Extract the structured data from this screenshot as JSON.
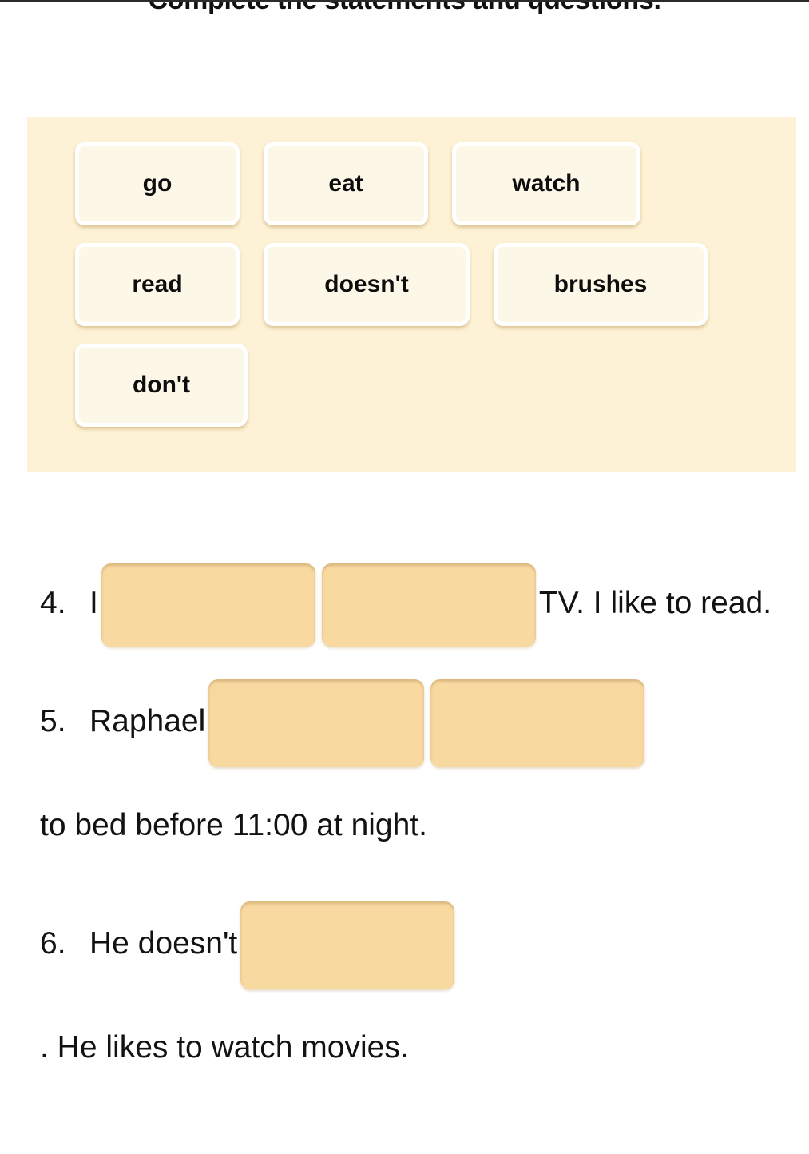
{
  "header": {
    "title": "Complete the statements and questions."
  },
  "word_bank": {
    "rows": [
      [
        {
          "label": "go"
        },
        {
          "label": "eat"
        },
        {
          "label": "watch"
        }
      ],
      [
        {
          "label": "read"
        },
        {
          "label": "doesn't"
        },
        {
          "label": "brushes"
        }
      ],
      [
        {
          "label": "don't"
        }
      ]
    ]
  },
  "questions": [
    {
      "number": "4.",
      "lead": "I",
      "mid": "",
      "tail": "TV. I like to read.",
      "blanks": 2
    },
    {
      "number": "5.",
      "lead": "Raphael",
      "mid": "",
      "tail": "to bed before 11:00 at night.",
      "blanks": 2
    },
    {
      "number": "6.",
      "lead": "He doesn't",
      "mid": "",
      "tail": ". He likes to watch movies.",
      "blanks": 1
    }
  ],
  "colors": {
    "panel_background": "#FDF2D6",
    "chip_fill": "#FDF7E8",
    "chip_border": "#FFFFFF",
    "blank_fill": "#F8D9A0",
    "text": "#121212",
    "page_background": "#FFFFFF"
  }
}
